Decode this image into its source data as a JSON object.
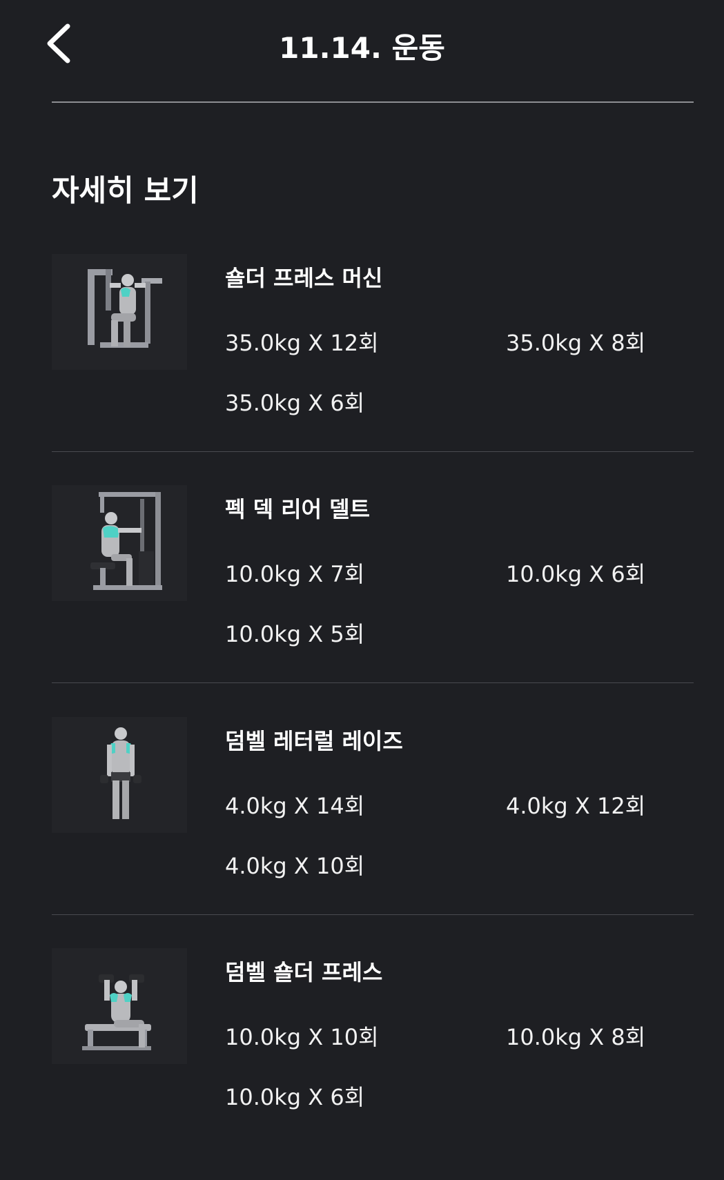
{
  "header": {
    "title": "11.14. 운동",
    "back_icon": "chevron-left-icon"
  },
  "section": {
    "heading": "자세히 보기"
  },
  "exercises": [
    {
      "name": "숄더 프레스 머신",
      "sets": [
        "35.0kg X 12회",
        "35.0kg X 8회",
        "35.0kg X 6회"
      ]
    },
    {
      "name": "펙 덱 리어 델트",
      "sets": [
        "10.0kg X 7회",
        "10.0kg X 6회",
        "10.0kg X 5회"
      ]
    },
    {
      "name": "덤벨 레터럴 레이즈",
      "sets": [
        "4.0kg X 14회",
        "4.0kg X 12회",
        "4.0kg X 10회"
      ]
    },
    {
      "name": "덤벨 숄더 프레스",
      "sets": [
        "10.0kg X 10회",
        "10.0kg X 8회",
        "10.0kg X 6회"
      ]
    }
  ],
  "colors": {
    "background": "#1e1f23",
    "text": "#ffffff",
    "muscle_highlight": "#4fd1c5"
  }
}
